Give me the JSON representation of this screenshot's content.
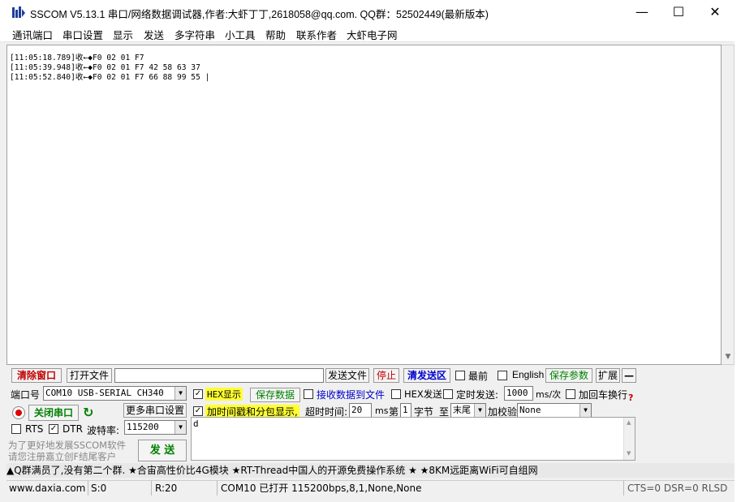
{
  "window": {
    "title": "SSCOM V5.13.1 串口/网络数据调试器,作者:大虾丁丁,2618058@qq.com. QQ群：52502449(最新版本)",
    "minimize": "—",
    "maximize": "☐",
    "close": "✕"
  },
  "menu": [
    "通讯端口",
    "串口设置",
    "显示",
    "发送",
    "多字符串",
    "小工具",
    "帮助",
    "联系作者",
    "大虾电子网"
  ],
  "receive": {
    "lines": [
      "[11:05:18.789]收←◆F0 02 01 F7",
      "[11:05:39.948]收←◆F0 02 01 F7 42 58 63 37",
      "[11:05:52.840]收←◆F0 02 01 F7 66 88 99 55 |"
    ]
  },
  "toolbar1": {
    "clear": "清除窗口",
    "open_file": "打开文件",
    "file_path": "",
    "send_file": "发送文件",
    "stop": "停止",
    "clear_send": "清发送区",
    "topmost": "最前",
    "english": "English",
    "save_params": "保存参数",
    "expand": "扩展",
    "collapse": "—"
  },
  "controls": {
    "port_label": "端口号",
    "port_value": "COM10 USB-SERIAL CH340",
    "hex_display": "HEX显示",
    "save_data": "保存数据",
    "recv_to_file": "接收数据到文件",
    "hex_send": "HEX发送",
    "timed_send": "定时发送:",
    "interval": "1000",
    "interval_unit": "ms/次",
    "add_crlf": "加回车换行",
    "help": "?",
    "close_port": "关闭串口",
    "more_settings": "更多串口设置",
    "timestamp": "加时间戳和分包显示,",
    "timeout_label": "超时时间:",
    "timeout_value": "20",
    "timeout_unit": "ms",
    "nth_label": "第",
    "nth_value": "1",
    "byte_label": "字节",
    "to_label": "至",
    "end_value": "末尾",
    "checksum_label": "加校验",
    "checksum_value": "None",
    "rts": "RTS",
    "dtr": "DTR",
    "baud_label": "波特率:",
    "baud_value": "115200",
    "send_text": "d",
    "promo1": "为了更好地发展SSCOM软件",
    "promo2": "请您注册嘉立创F结尾客户",
    "send": "发  送"
  },
  "ticker": "▲Q群满员了,没有第二个群. ★合宙高性价比4G模块 ★RT-Thread中国人的开源免费操作系统 ★ ★8KM远距离WiFi可自组网",
  "status": {
    "site": "www.daxia.com",
    "sent": "S:0",
    "received": "R:20",
    "port_state": "COM10 已打开  115200bps,8,1,None,None",
    "signals": "CTS=0 DSR=0 RLSD"
  },
  "colors": {
    "accent_red": "#c00000",
    "accent_blue": "#0000cc",
    "accent_green": "#008000",
    "highlight": "#ffff33"
  }
}
